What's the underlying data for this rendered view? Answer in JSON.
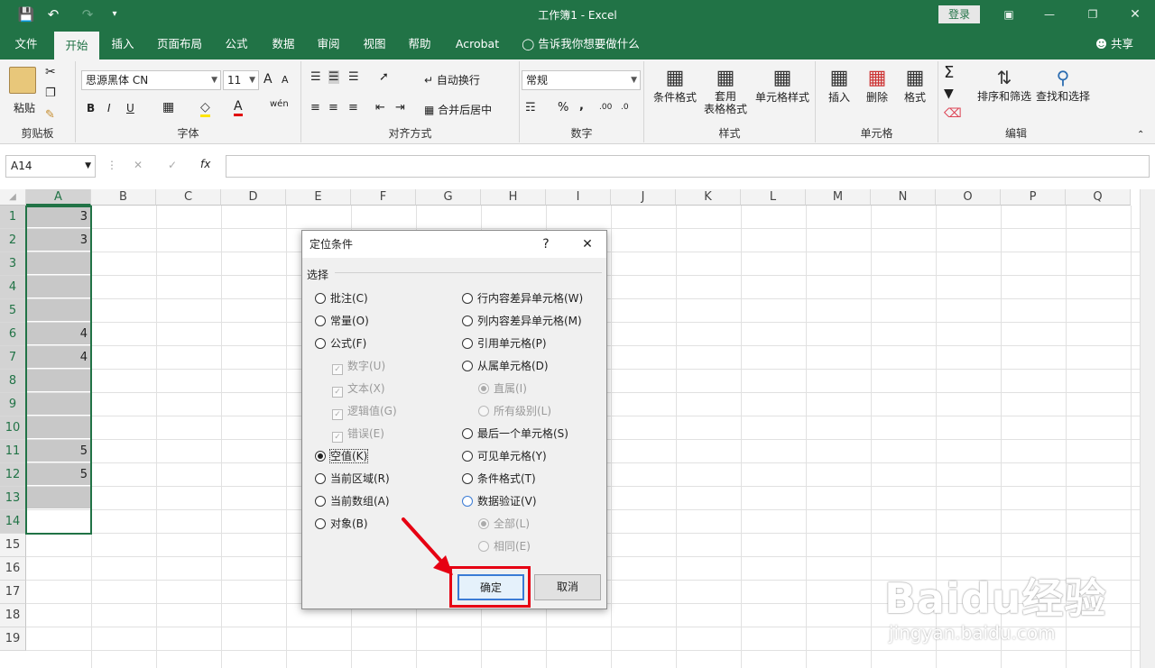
{
  "titlebar": {
    "title": "工作簿1  -  Excel",
    "login": "登录",
    "save_icon": "save-icon",
    "undo_icon": "undo-icon",
    "redo_icon": "redo-icon"
  },
  "tabs": [
    "文件",
    "开始",
    "插入",
    "页面布局",
    "公式",
    "数据",
    "审阅",
    "视图",
    "帮助",
    "Acrobat"
  ],
  "active_tab": "开始",
  "tellme": "告诉我你想要做什么",
  "share": "共享",
  "ribbon": {
    "clipboard": {
      "label": "剪贴板",
      "paste": "粘贴"
    },
    "font": {
      "label": "字体",
      "name": "思源黑体 CN",
      "size": "11",
      "bold": "B",
      "italic": "I",
      "underline": "U",
      "wen": "wén",
      "grow": "A",
      "shrink": "A"
    },
    "align": {
      "label": "对齐方式",
      "wrap": "自动换行",
      "merge": "合并后居中"
    },
    "number": {
      "label": "数字",
      "format": "常规",
      "percent": "%",
      "comma": ",",
      "inc": ".00",
      "dec": ".0"
    },
    "styles": {
      "label": "样式",
      "cond": "条件格式",
      "table1": "套用",
      "table2": "表格格式",
      "cell": "单元格样式"
    },
    "cells": {
      "label": "单元格",
      "insert": "插入",
      "delete": "删除",
      "format": "格式"
    },
    "edit": {
      "label": "编辑",
      "sort": "排序和筛选",
      "find": "查找和选择"
    }
  },
  "formula_bar": {
    "namebox": "A14",
    "fx": "fx",
    "cancel": "✕",
    "enter": "✓"
  },
  "columns": [
    "A",
    "B",
    "C",
    "D",
    "E",
    "F",
    "G",
    "H",
    "I",
    "J",
    "K",
    "L",
    "M",
    "N",
    "O",
    "P",
    "Q"
  ],
  "rows": [
    "1",
    "2",
    "3",
    "4",
    "5",
    "6",
    "7",
    "8",
    "9",
    "10",
    "11",
    "12",
    "13",
    "14",
    "15",
    "16",
    "17",
    "18",
    "19"
  ],
  "colA_values": [
    "3",
    "3",
    "",
    "",
    "",
    "4",
    "4",
    "",
    "",
    "",
    "5",
    "5",
    "",
    ""
  ],
  "dialog": {
    "title": "定位条件",
    "help": "?",
    "close": "✕",
    "section": "选择",
    "left": [
      {
        "label": "批注(C)",
        "type": "radio",
        "checked": false,
        "disabled": false
      },
      {
        "label": "常量(O)",
        "type": "radio",
        "checked": false,
        "disabled": false
      },
      {
        "label": "公式(F)",
        "type": "radio",
        "checked": false,
        "disabled": false
      },
      {
        "label": "数字(U)",
        "type": "check",
        "checked": true,
        "disabled": true
      },
      {
        "label": "文本(X)",
        "type": "check",
        "checked": true,
        "disabled": true
      },
      {
        "label": "逻辑值(G)",
        "type": "check",
        "checked": true,
        "disabled": true
      },
      {
        "label": "错误(E)",
        "type": "check",
        "checked": true,
        "disabled": true
      },
      {
        "label": "空值(K)",
        "type": "radio",
        "checked": true,
        "disabled": false
      },
      {
        "label": "当前区域(R)",
        "type": "radio",
        "checked": false,
        "disabled": false
      },
      {
        "label": "当前数组(A)",
        "type": "radio",
        "checked": false,
        "disabled": false
      },
      {
        "label": "对象(B)",
        "type": "radio",
        "checked": false,
        "disabled": false
      }
    ],
    "right": [
      {
        "label": "行内容差异单元格(W)",
        "type": "radio",
        "checked": false,
        "disabled": false
      },
      {
        "label": "列内容差异单元格(M)",
        "type": "radio",
        "checked": false,
        "disabled": false
      },
      {
        "label": "引用单元格(P)",
        "type": "radio",
        "checked": false,
        "disabled": false
      },
      {
        "label": "从属单元格(D)",
        "type": "radio",
        "checked": false,
        "disabled": false
      },
      {
        "label": "直属(I)",
        "type": "radio",
        "checked": true,
        "disabled": true
      },
      {
        "label": "所有级别(L)",
        "type": "radio",
        "checked": false,
        "disabled": true
      },
      {
        "label": "最后一个单元格(S)",
        "type": "radio",
        "checked": false,
        "disabled": false
      },
      {
        "label": "可见单元格(Y)",
        "type": "radio",
        "checked": false,
        "disabled": false
      },
      {
        "label": "条件格式(T)",
        "type": "radio",
        "checked": false,
        "disabled": false
      },
      {
        "label": "数据验证(V)",
        "type": "radio",
        "checked": false,
        "disabled": false
      },
      {
        "label": "全部(L)",
        "type": "radio",
        "checked": true,
        "disabled": true
      },
      {
        "label": "相同(E)",
        "type": "radio",
        "checked": false,
        "disabled": true
      }
    ],
    "ok": "确定",
    "cancel": "取消"
  },
  "watermark": {
    "logo": "Baidu经验",
    "url": "jingyan.baidu.com"
  },
  "colors": {
    "excel_green": "#217346",
    "highlight": "#e60012",
    "selection_fill": "#c8c8c8"
  }
}
